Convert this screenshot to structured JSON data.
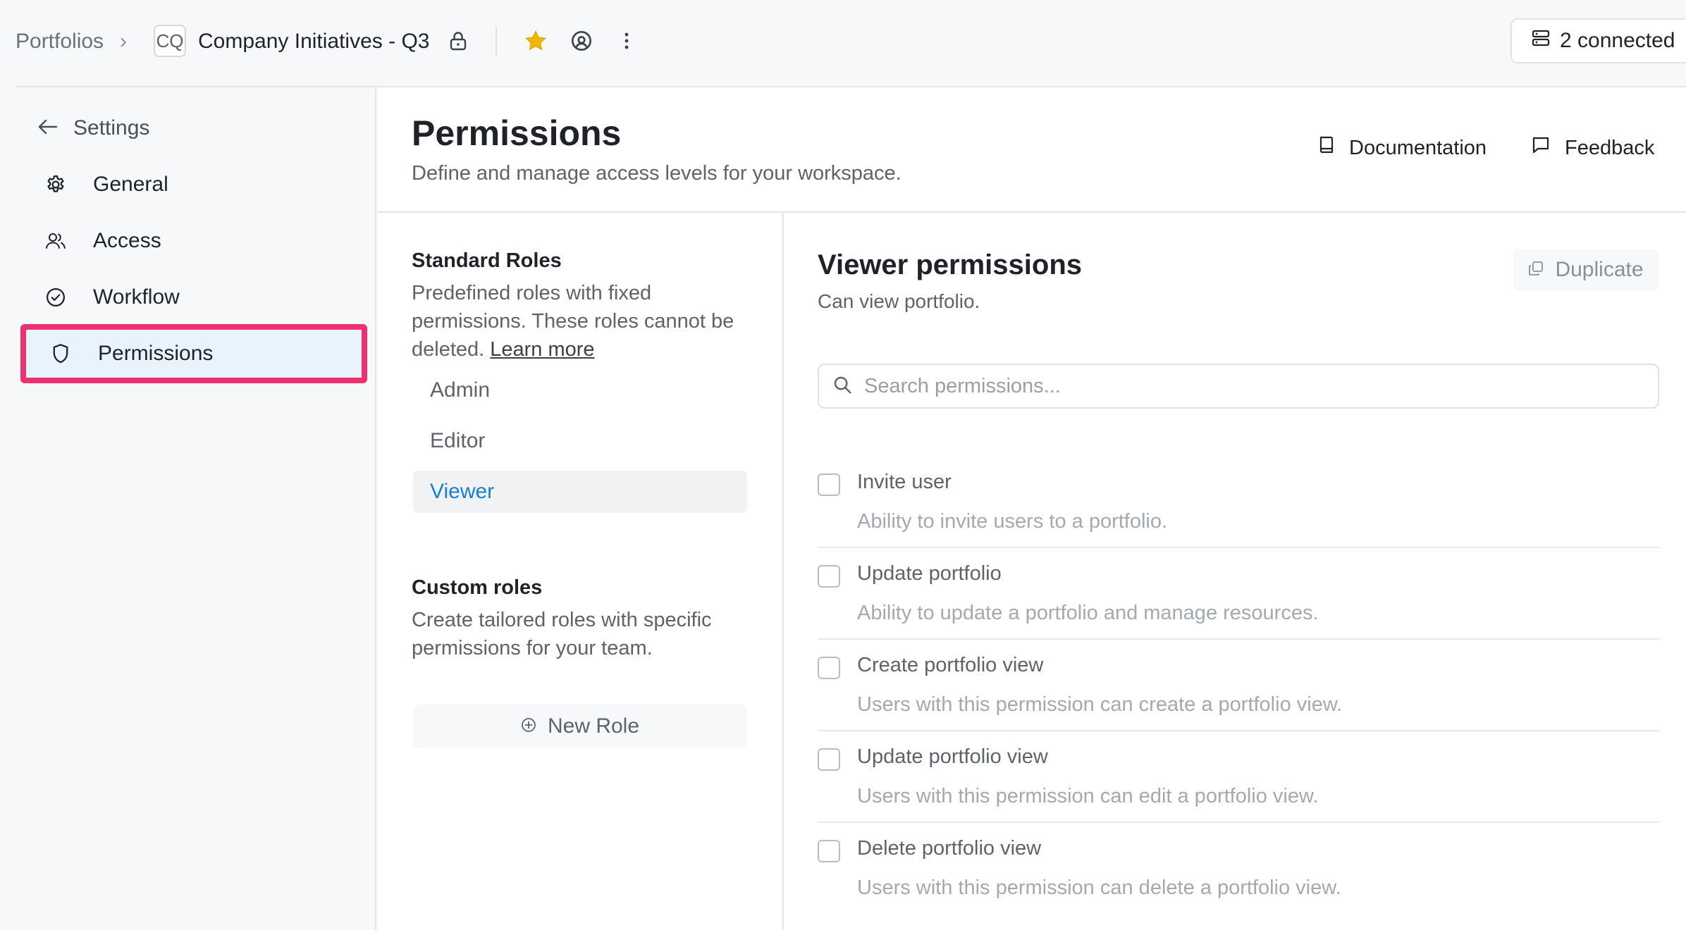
{
  "topbar": {
    "breadcrumb_root": "Portfolios",
    "breadcrumb_separator": "›",
    "workspace_badge": "CQ",
    "workspace_name": "Company Initiatives - Q3",
    "icons": [
      "chevron-right-icon",
      "lock-icon",
      "star-icon",
      "at-sign-icon",
      "more-vertical-icon",
      "server-icon"
    ],
    "star_color": "#f2b705",
    "connected_label": "2 connected"
  },
  "sidebar": {
    "back_label": "Settings",
    "items": [
      {
        "label": "General",
        "icon": "gear-icon"
      },
      {
        "label": "Access",
        "icon": "users-icon"
      },
      {
        "label": "Workflow",
        "icon": "check-circle-icon"
      },
      {
        "label": "Permissions",
        "icon": "shield-icon",
        "active": true
      }
    ],
    "highlight_color": "#f0316f"
  },
  "header": {
    "title": "Permissions",
    "subtitle": "Define and manage access levels for your workspace.",
    "documentation_label": "Documentation",
    "feedback_label": "Feedback"
  },
  "roles": {
    "standard_title": "Standard Roles",
    "standard_desc": "Predefined roles with fixed permissions. These roles cannot be deleted.",
    "learn_more": "Learn more",
    "items": [
      "Admin",
      "Editor",
      "Viewer"
    ],
    "selected": "Viewer",
    "accent_color": "#1a7fd4",
    "custom_title": "Custom roles",
    "custom_desc": "Create tailored roles with specific permissions for your team.",
    "new_role_label": "New Role"
  },
  "permissions": {
    "title": "Viewer permissions",
    "subtitle": "Can view portfolio.",
    "duplicate_label": "Duplicate",
    "search_placeholder": "Search permissions...",
    "items": [
      {
        "name": "Invite user",
        "desc": "Ability to invite users to a portfolio.",
        "checked": false
      },
      {
        "name": "Update portfolio",
        "desc": "Ability to update a portfolio and manage resources.",
        "checked": false
      },
      {
        "name": "Create portfolio view",
        "desc": "Users with this permission can create a portfolio view.",
        "checked": false
      },
      {
        "name": "Update portfolio view",
        "desc": "Users with this permission can edit a portfolio view.",
        "checked": false
      },
      {
        "name": "Delete portfolio view",
        "desc": "Users with this permission can delete a portfolio view.",
        "checked": false
      }
    ]
  }
}
